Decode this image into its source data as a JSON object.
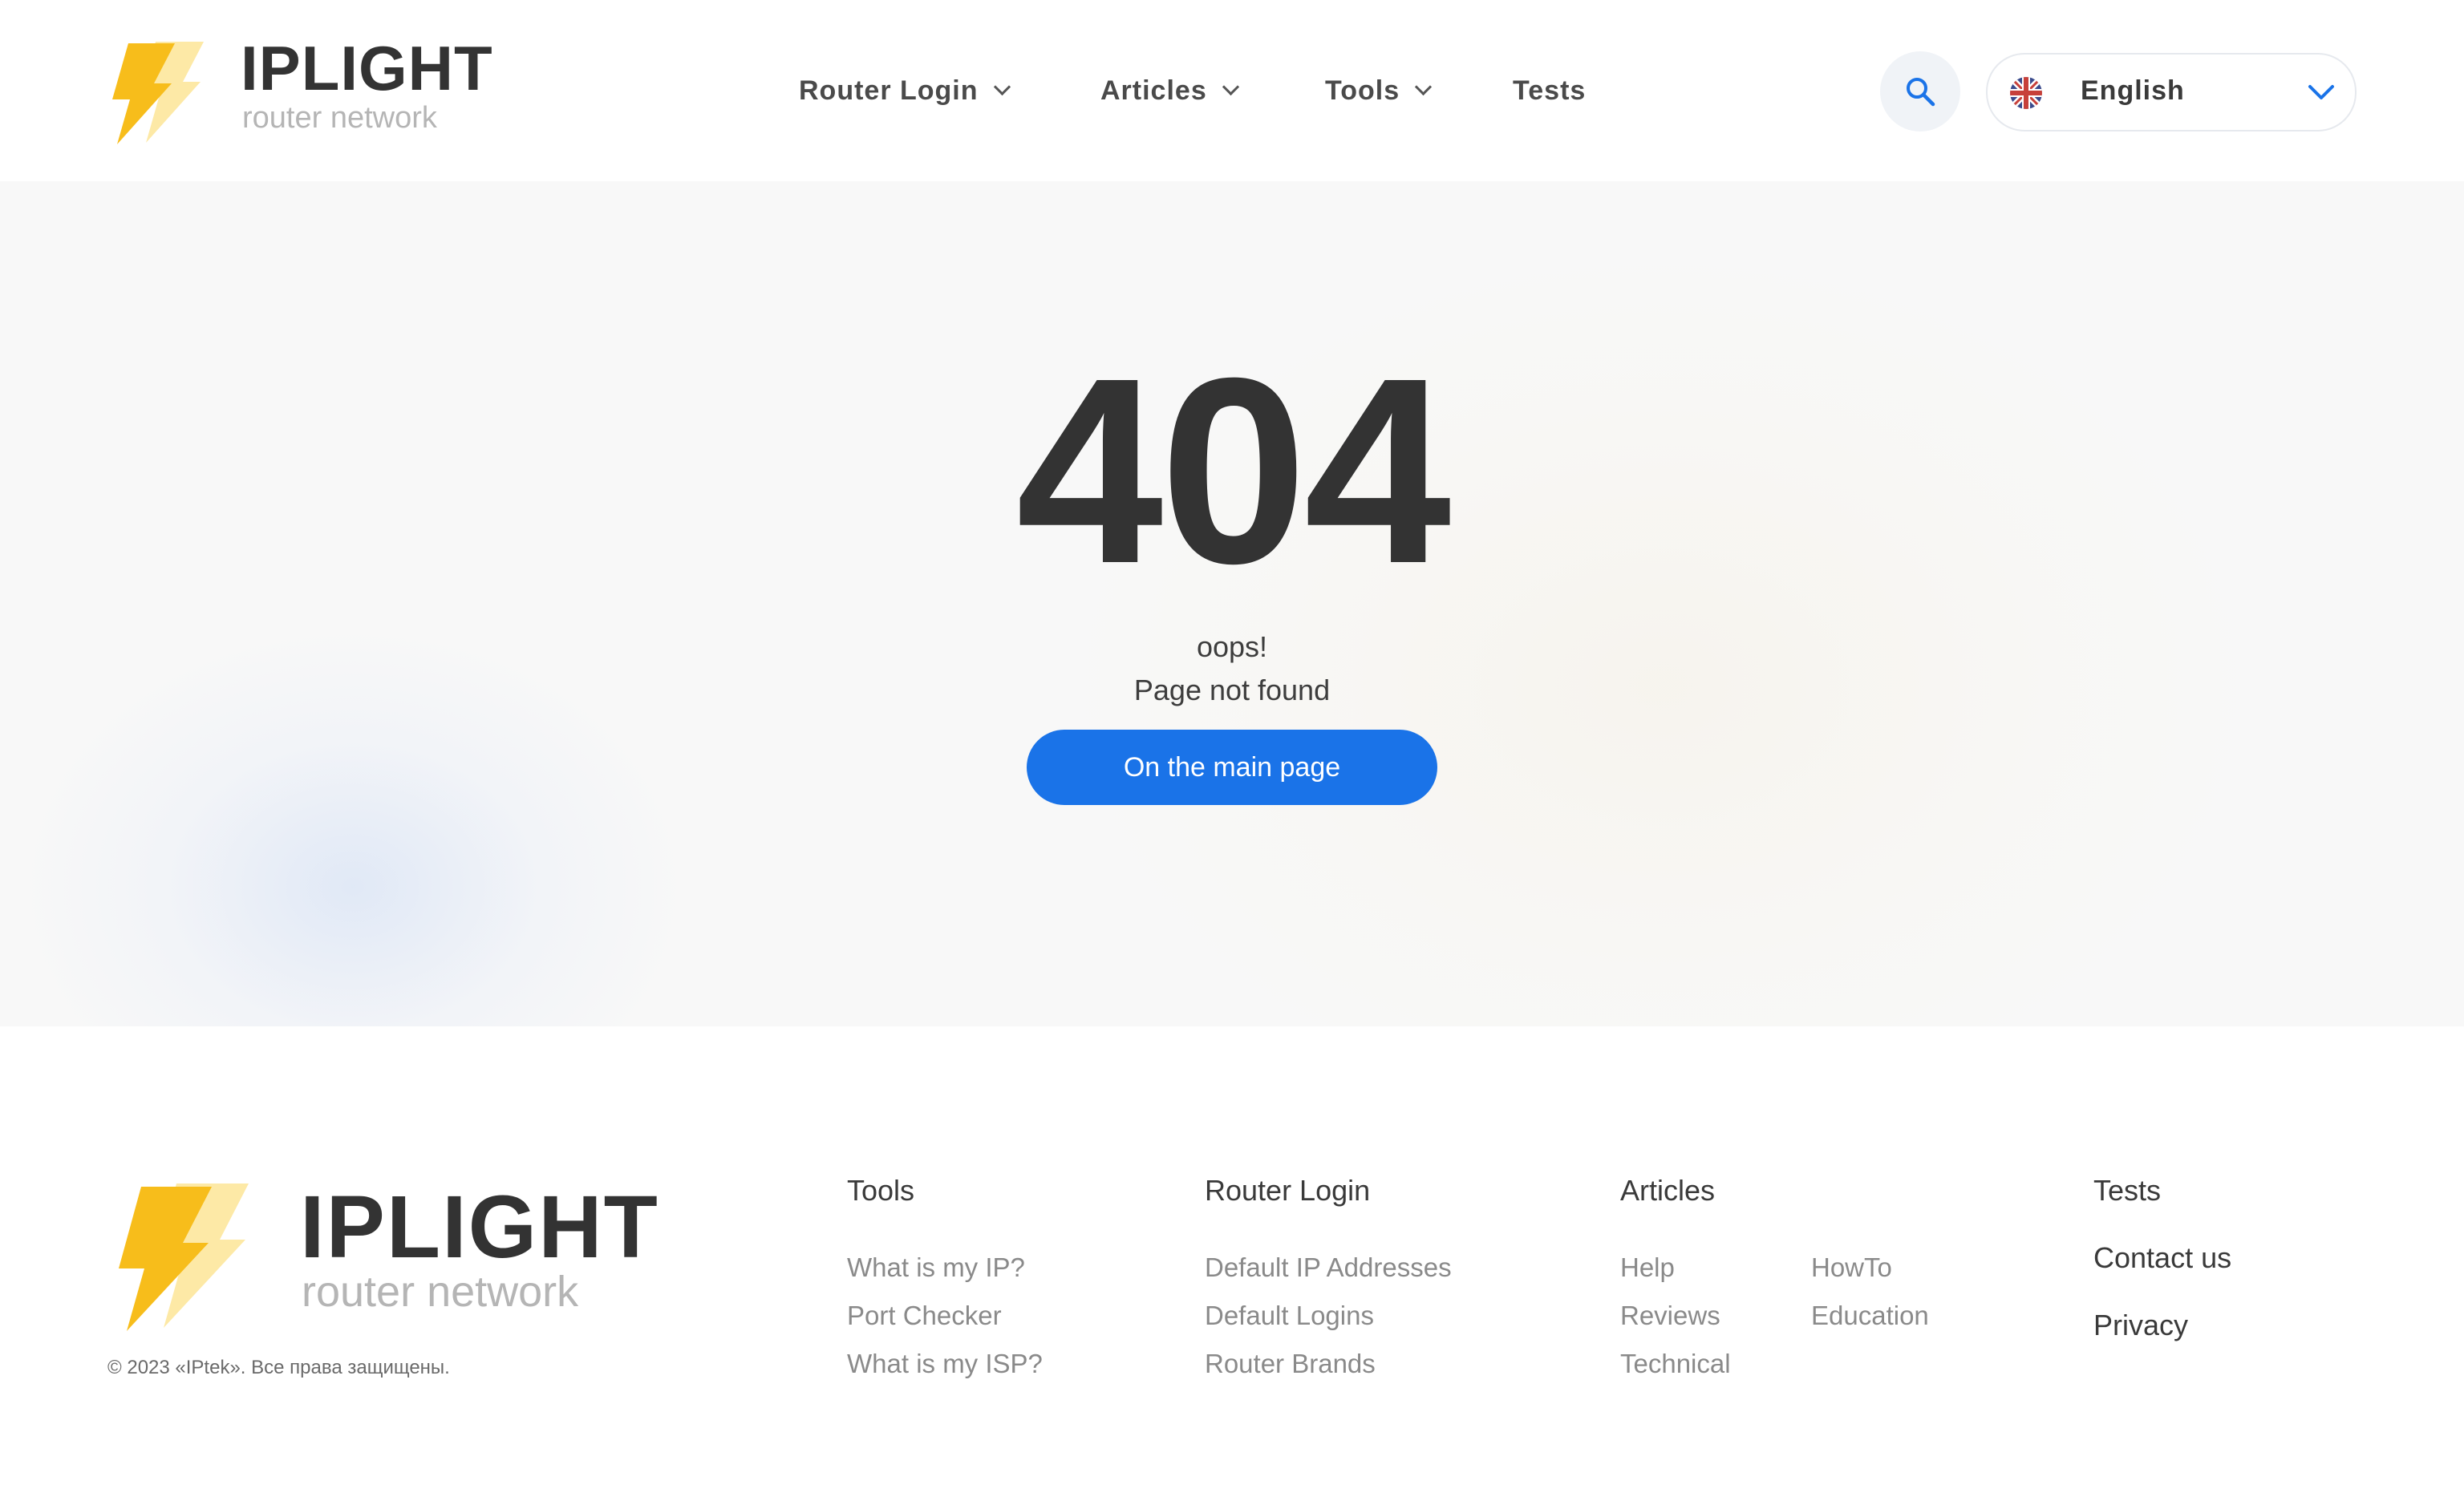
{
  "header": {
    "logo": {
      "brand": "IPLIGHT",
      "tagline": "router network"
    },
    "nav": [
      {
        "label": "Router Login",
        "has_dropdown": true
      },
      {
        "label": "Articles",
        "has_dropdown": true
      },
      {
        "label": "Tools",
        "has_dropdown": true
      },
      {
        "label": "Tests",
        "has_dropdown": false
      }
    ],
    "search_icon": "search-icon",
    "language": {
      "label": "English",
      "flag": "uk-flag-icon"
    }
  },
  "main": {
    "code": "404",
    "line1": "oops!",
    "line2": "Page not found",
    "button_label": "On the main page"
  },
  "footer": {
    "logo": {
      "brand": "IPLIGHT",
      "tagline": "router network"
    },
    "copyright": "© 2023 «IPtek». Все права защищены.",
    "columns": {
      "tools": {
        "title": "Tools",
        "links": [
          "What is my IP?",
          "Port Checker",
          "What is my ISP?"
        ]
      },
      "router_login": {
        "title": "Router Login",
        "links": [
          "Default IP Addresses",
          "Default Logins",
          "Router Brands"
        ]
      },
      "articles": {
        "title": "Articles",
        "links": [
          "Help",
          "Reviews",
          "Technical",
          "HowTo",
          "Education"
        ]
      }
    },
    "extra_links": [
      "Tests",
      "Contact us",
      "Privacy"
    ]
  },
  "colors": {
    "accent_blue": "#1a73e8",
    "logo_yellow": "#f7bd1b",
    "logo_yellow_light": "#fde9a6",
    "text_dark": "#333333",
    "text_muted": "#8a8a8a"
  }
}
